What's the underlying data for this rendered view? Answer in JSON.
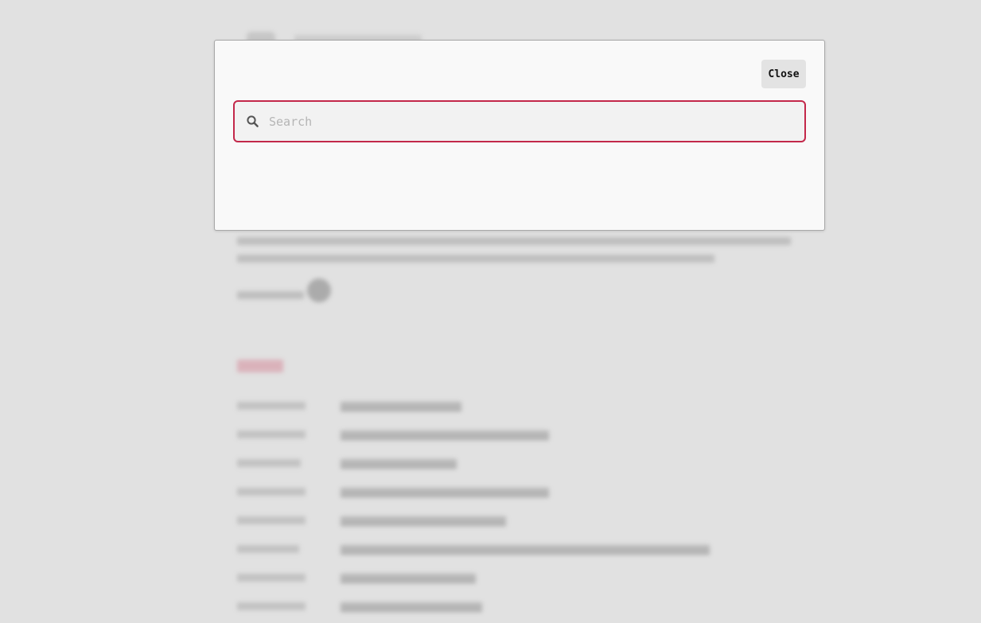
{
  "search_dialog": {
    "close_label": "Close",
    "search_placeholder": "Search",
    "search_value": "",
    "accent_color": "#c3284a",
    "search_icon": "search-icon"
  }
}
